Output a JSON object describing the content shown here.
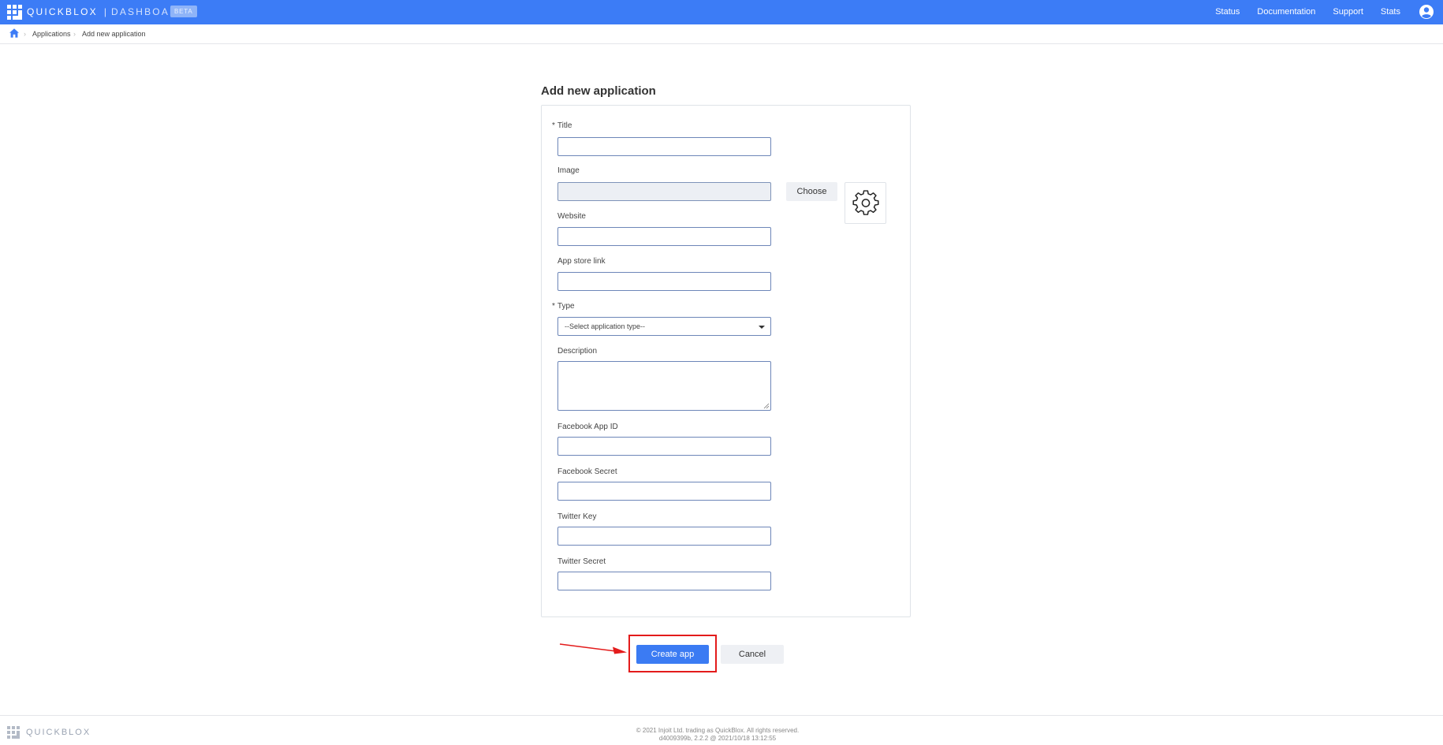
{
  "topbar": {
    "brand": "QUICKBLOX",
    "separator": "|",
    "product": "DASHBOARD",
    "badge": "BETA",
    "nav": [
      "Status",
      "Documentation",
      "Support",
      "Stats"
    ],
    "color": "#3c7cf6"
  },
  "breadcrumb": {
    "items": [
      "Applications",
      "Add new application"
    ]
  },
  "form": {
    "title": "Add new application",
    "fields": {
      "title": {
        "label": "Title",
        "required": "*",
        "value": ""
      },
      "image": {
        "label": "Image",
        "value": "",
        "choose_label": "Choose"
      },
      "website": {
        "label": "Website",
        "value": ""
      },
      "app_store_link": {
        "label": "App store link",
        "value": ""
      },
      "type": {
        "label": "Type",
        "required": "*",
        "selected": "--Select application type--"
      },
      "description": {
        "label": "Description",
        "value": ""
      },
      "facebook_app_id": {
        "label": "Facebook App ID",
        "value": ""
      },
      "facebook_secret": {
        "label": "Facebook Secret",
        "value": ""
      },
      "twitter_key": {
        "label": "Twitter Key",
        "value": ""
      },
      "twitter_secret": {
        "label": "Twitter Secret",
        "value": ""
      }
    },
    "actions": {
      "create": "Create app",
      "cancel": "Cancel"
    },
    "accent_color": "#3b7bf3",
    "highlight_color": "#e31b1b"
  },
  "footer": {
    "brand": "QUICKBLOX",
    "copyright": "© 2021 Injoit Ltd. trading as QuickBlox. All rights reserved.",
    "build": "d4009399b, 2.2.2 @ 2021/10/18 13:12:55"
  }
}
